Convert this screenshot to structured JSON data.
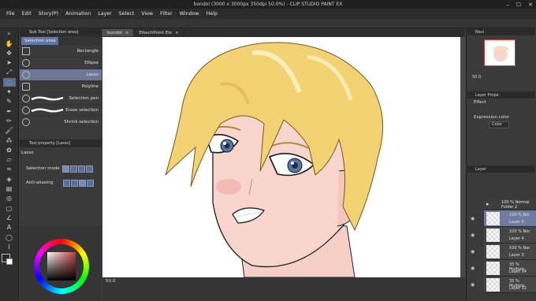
{
  "window": {
    "title": "bondol (3000 x 3000px 350dpi 50.0%)  - CLIP STUDIO PAINT EX"
  },
  "menu": [
    "File",
    "Edit",
    "Story(P)",
    "Animation",
    "Layer",
    "Select",
    "View",
    "Filter",
    "Window",
    "Help"
  ],
  "subtool": {
    "header": "Sub Tool [Selection area]",
    "tab": "Selection area",
    "items": [
      {
        "label": "Rectangle",
        "selected": false
      },
      {
        "label": "Ellipse",
        "selected": false
      },
      {
        "label": "Lasso",
        "selected": true
      },
      {
        "label": "Polyline",
        "selected": false
      },
      {
        "label": "Selection pen",
        "selected": false
      },
      {
        "label": "Erase selection",
        "selected": false
      },
      {
        "label": "Shrink selection",
        "selected": false
      }
    ]
  },
  "tool_property": {
    "header": "Tool property [Lasso]",
    "tool_name": "Lasso",
    "selection_mode_label": "Selection mode",
    "anti_aliasing_label": "Anti-aliasing"
  },
  "doc_tabs": [
    {
      "label": "bondol",
      "active": true
    },
    {
      "label": "ElkechPoint Ele",
      "active": false
    }
  ],
  "status": {
    "zoom": "50.0"
  },
  "right": {
    "navigator_zoom": "50.0",
    "layer_property_header": "Layer Prope",
    "effect_label": "Effect",
    "expression_color_label": "Expression color",
    "color_option": "Color",
    "layer_header": "Layer",
    "folder": {
      "mode": "100 % Normal",
      "name": "Folder 2"
    },
    "layers": [
      {
        "mode": "100 % Nor",
        "name": "Layer 5",
        "selected": true
      },
      {
        "mode": "100 % Nor",
        "name": "Layer 4",
        "selected": false
      },
      {
        "mode": "100 % Nor",
        "name": "Layer 3",
        "selected": false
      },
      {
        "mode": "35 % Multiply",
        "name": "Layer 14",
        "selected": false
      },
      {
        "mode": "35 % Multiply",
        "name": "Layer 12",
        "selected": false
      }
    ]
  },
  "colors": {
    "accent": "#6e7896",
    "hair": "#f2d272",
    "skin": "#f8d4cc",
    "iris": "#5478a8"
  },
  "icons": [
    "minimize-icon",
    "maximize-icon",
    "close-icon",
    "magnifier-icon",
    "move-icon",
    "lasso-icon",
    "eyedropper-icon",
    "pen-icon",
    "brush-icon",
    "eraser-icon",
    "fill-icon",
    "eye-icon",
    "folder-icon"
  ]
}
